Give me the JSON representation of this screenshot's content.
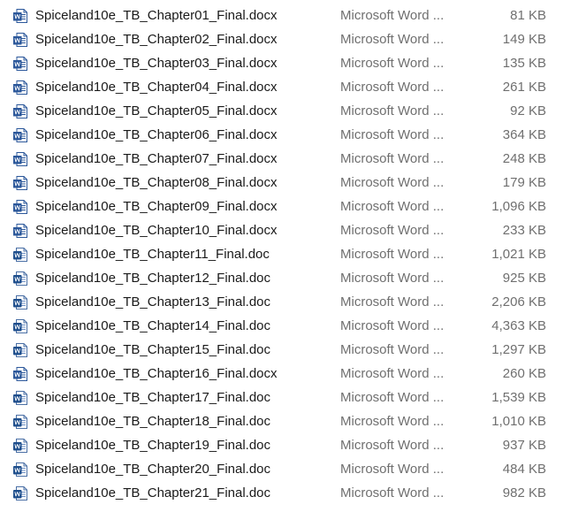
{
  "file_list": {
    "rows": [
      {
        "name": "Spiceland10e_TB_Chapter01_Final.docx",
        "type": "Microsoft Word ...",
        "size": "81 KB",
        "icon": "word-docx-icon"
      },
      {
        "name": "Spiceland10e_TB_Chapter02_Final.docx",
        "type": "Microsoft Word ...",
        "size": "149 KB",
        "icon": "word-docx-icon"
      },
      {
        "name": "Spiceland10e_TB_Chapter03_Final.docx",
        "type": "Microsoft Word ...",
        "size": "135 KB",
        "icon": "word-docx-icon"
      },
      {
        "name": "Spiceland10e_TB_Chapter04_Final.docx",
        "type": "Microsoft Word ...",
        "size": "261 KB",
        "icon": "word-docx-icon"
      },
      {
        "name": "Spiceland10e_TB_Chapter05_Final.docx",
        "type": "Microsoft Word ...",
        "size": "92 KB",
        "icon": "word-docx-icon"
      },
      {
        "name": "Spiceland10e_TB_Chapter06_Final.docx",
        "type": "Microsoft Word ...",
        "size": "364 KB",
        "icon": "word-docx-icon"
      },
      {
        "name": "Spiceland10e_TB_Chapter07_Final.docx",
        "type": "Microsoft Word ...",
        "size": "248 KB",
        "icon": "word-docx-icon"
      },
      {
        "name": "Spiceland10e_TB_Chapter08_Final.docx",
        "type": "Microsoft Word ...",
        "size": "179 KB",
        "icon": "word-docx-icon"
      },
      {
        "name": "Spiceland10e_TB_Chapter09_Final.docx",
        "type": "Microsoft Word ...",
        "size": "1,096 KB",
        "icon": "word-docx-icon"
      },
      {
        "name": "Spiceland10e_TB_Chapter10_Final.docx",
        "type": "Microsoft Word ...",
        "size": "233 KB",
        "icon": "word-docx-icon"
      },
      {
        "name": "Spiceland10e_TB_Chapter11_Final.doc",
        "type": "Microsoft Word ...",
        "size": "1,021 KB",
        "icon": "word-doc-icon"
      },
      {
        "name": "Spiceland10e_TB_Chapter12_Final.doc",
        "type": "Microsoft Word ...",
        "size": "925 KB",
        "icon": "word-doc-icon"
      },
      {
        "name": "Spiceland10e_TB_Chapter13_Final.doc",
        "type": "Microsoft Word ...",
        "size": "2,206 KB",
        "icon": "word-doc-icon"
      },
      {
        "name": "Spiceland10e_TB_Chapter14_Final.doc",
        "type": "Microsoft Word ...",
        "size": "4,363 KB",
        "icon": "word-doc-icon"
      },
      {
        "name": "Spiceland10e_TB_Chapter15_Final.doc",
        "type": "Microsoft Word ...",
        "size": "1,297 KB",
        "icon": "word-doc-icon"
      },
      {
        "name": "Spiceland10e_TB_Chapter16_Final.docx",
        "type": "Microsoft Word ...",
        "size": "260 KB",
        "icon": "word-docx-icon"
      },
      {
        "name": "Spiceland10e_TB_Chapter17_Final.doc",
        "type": "Microsoft Word ...",
        "size": "1,539 KB",
        "icon": "word-doc-icon"
      },
      {
        "name": "Spiceland10e_TB_Chapter18_Final.doc",
        "type": "Microsoft Word ...",
        "size": "1,010 KB",
        "icon": "word-doc-icon"
      },
      {
        "name": "Spiceland10e_TB_Chapter19_Final.doc",
        "type": "Microsoft Word ...",
        "size": "937 KB",
        "icon": "word-doc-icon"
      },
      {
        "name": "Spiceland10e_TB_Chapter20_Final.doc",
        "type": "Microsoft Word ...",
        "size": "484 KB",
        "icon": "word-doc-icon"
      },
      {
        "name": "Spiceland10e_TB_Chapter21_Final.doc",
        "type": "Microsoft Word ...",
        "size": "982 KB",
        "icon": "word-doc-icon"
      }
    ]
  },
  "colors": {
    "word_blue": "#2b579a",
    "word_blue_dark": "#1e4e8c",
    "name_text": "#1a1a1a",
    "meta_text": "#6f6f6f"
  }
}
